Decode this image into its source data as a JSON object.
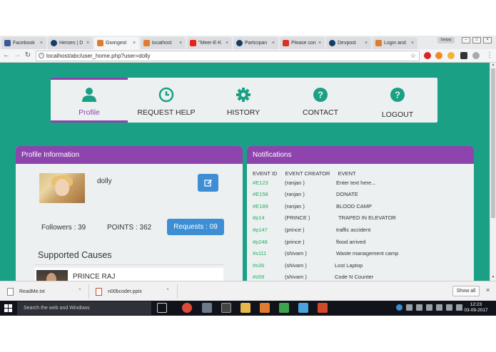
{
  "browser": {
    "tabs": [
      {
        "label": "Facebook",
        "color": "#3b5998",
        "active": false
      },
      {
        "label": "Heroes | D",
        "color": "#123c69",
        "active": false
      },
      {
        "label": "Givingest",
        "color": "#e27b2f",
        "active": true
      },
      {
        "label": "localhost",
        "color": "#e27b2f",
        "active": false
      },
      {
        "label": "\"Meer-E-K",
        "color": "#e62117",
        "active": false
      },
      {
        "label": "Participan",
        "color": "#123c69",
        "active": false
      },
      {
        "label": "Please con",
        "color": "#d93025",
        "active": false
      },
      {
        "label": "Devpost",
        "color": "#123c69",
        "active": false
      },
      {
        "label": "Login and",
        "color": "#e27b2f",
        "active": false
      }
    ],
    "user_chip": "Sanjay",
    "url": "localhost/abc/user_home.php?user=dolly"
  },
  "nav": {
    "items": [
      {
        "label": "Profile",
        "icon": "user-icon",
        "active": true
      },
      {
        "label": "REQUEST HELP",
        "icon": "clock-icon",
        "active": false
      },
      {
        "label": "HISTORY",
        "icon": "gear-icon",
        "active": false
      },
      {
        "label": "CONTACT",
        "icon": "question-icon",
        "active": false
      },
      {
        "label": "LOGOUT",
        "icon": "question-icon",
        "active": false
      }
    ]
  },
  "profile": {
    "title": "Profile Information",
    "username": "dolly",
    "followers": "Followers : 39",
    "points": "POINTS : 362",
    "requests": "Requests : 09",
    "supported_title": "Supported Causes",
    "causes": [
      {
        "name": "PRINCE RAJ"
      }
    ]
  },
  "notifications": {
    "title": "Notifications",
    "col_id": "EVENT ID",
    "col_creator": "EVENT CREATOR",
    "col_event": "EVENT",
    "rows": [
      {
        "id": "#E123",
        "creator": "(ranjan )",
        "event": "Enter text here..."
      },
      {
        "id": "#E158",
        "creator": "(ranjan )",
        "event": "DONATE"
      },
      {
        "id": "#E189",
        "creator": "(ranjan )",
        "event": "BLOOD CAMP"
      },
      {
        "id": "#p14",
        "creator": "(PRINCE )",
        "event": "TRAPED IN ELEVATOR"
      },
      {
        "id": "#p147",
        "creator": "(prince )",
        "event": "traffic accident"
      },
      {
        "id": "#p248",
        "creator": "(prince )",
        "event": "flood arrived"
      },
      {
        "id": "#s111",
        "creator": "(shivam )",
        "event": "Waste management camp"
      },
      {
        "id": "#s36",
        "creator": "(shivam )",
        "event": "Lost Laptop"
      },
      {
        "id": "#s59",
        "creator": "(shivam )",
        "event": "Code N Counter"
      }
    ]
  },
  "downloads": {
    "items": [
      {
        "name": "ReadMe.txt"
      },
      {
        "name": "n00bcoder.pptx"
      }
    ],
    "show_all": "Show all"
  },
  "taskbar": {
    "search_placeholder": "Search the web and Windows",
    "time": "12:23",
    "date": "03-09-2017"
  },
  "colors": {
    "page_bg": "#1aa085",
    "accent_purple": "#8e44ad",
    "button_blue": "#3d8ed4",
    "event_id_green": "#27ae60"
  }
}
